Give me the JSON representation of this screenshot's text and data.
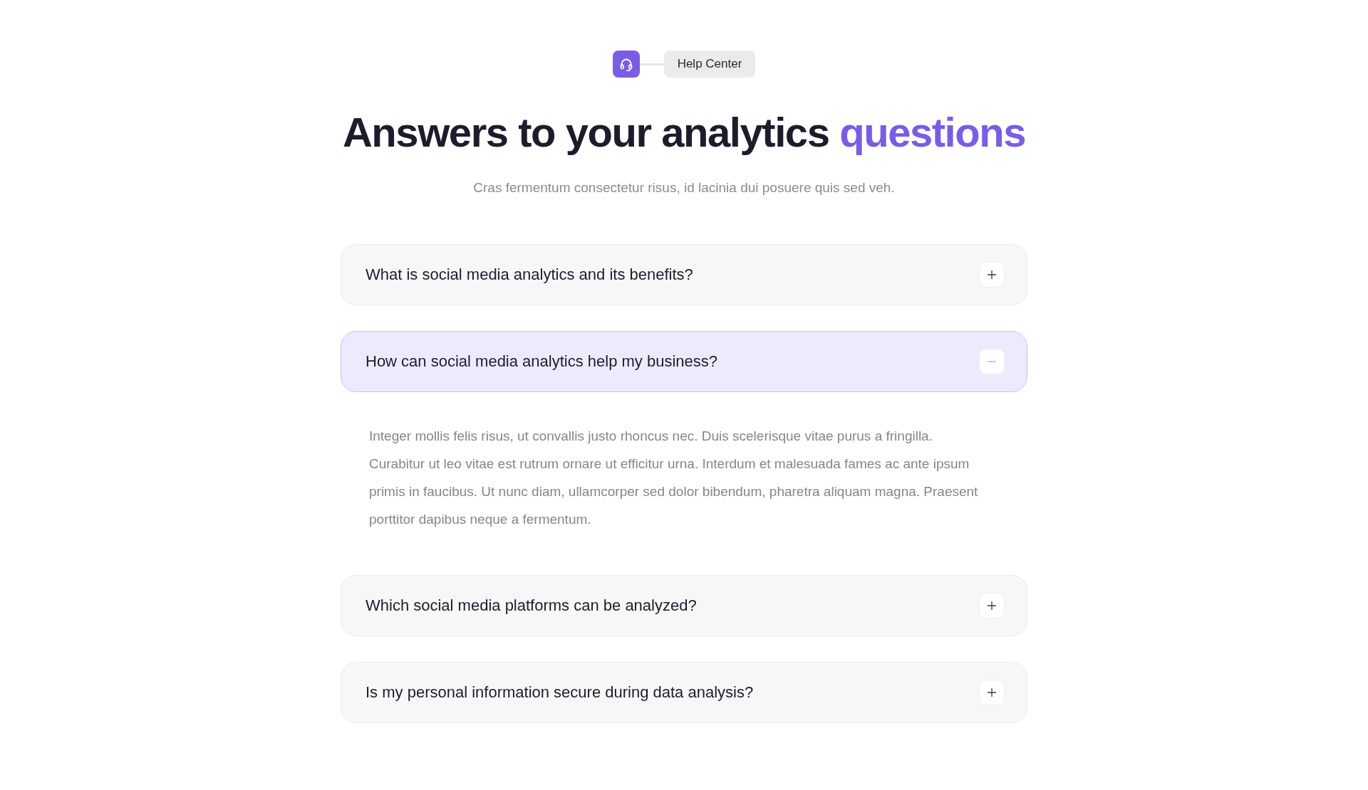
{
  "badge": {
    "label": "Help Center"
  },
  "heading": {
    "text": "Answers to your analytics",
    "highlight": "questions"
  },
  "subtitle": "Cras fermentum consectetur risus, id lacinia dui posuere quis sed veh.",
  "faq": [
    {
      "question": "What is social media analytics and its benefits?",
      "expanded": false
    },
    {
      "question": "How can social media analytics help my business?",
      "expanded": true,
      "answer": "Integer mollis felis risus, ut convallis justo rhoncus nec. Duis scelerisque vitae purus a fringilla. Curabitur ut leo vitae est rutrum ornare ut efficitur urna. Interdum et malesuada fames ac ante ipsum primis in faucibus. Ut nunc diam, ullamcorper sed dolor bibendum, pharetra aliquam magna. Praesent porttitor dapibus neque a fermentum."
    },
    {
      "question": "Which social media platforms can be analyzed?",
      "expanded": false
    },
    {
      "question": "Is my personal information secure during data analysis?",
      "expanded": false
    }
  ]
}
